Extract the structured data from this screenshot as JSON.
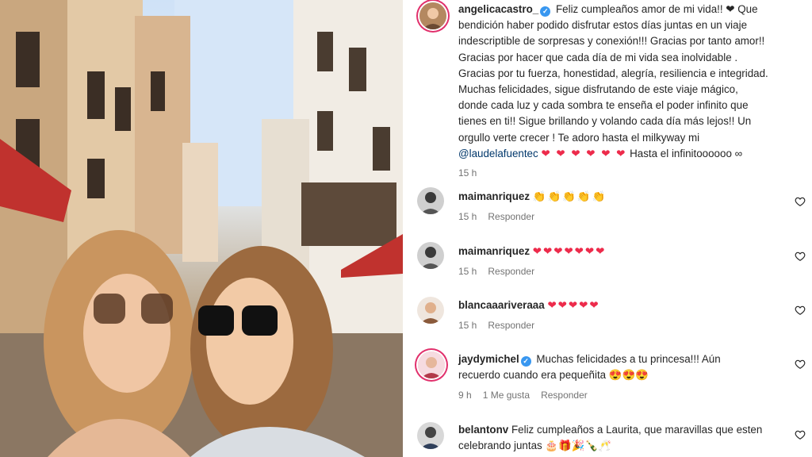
{
  "caption": {
    "username": "angelicacastro_",
    "text_lines": [
      "Feliz cumpleaños amor de mi vida!! ❤ Que",
      "bendición haber podido disfrutar estos días juntas en un viaje",
      "indescriptible de sorpresas y conexión!!! Gracias por tanto amor!!",
      "Gracias por hacer que cada día de mi vida sea inolvidable .",
      "Gracias por tu fuerza, honestidad, alegría, resiliencia e integridad.",
      "Muchas felicidades, sigue disfrutando de este viaje mágico,",
      "donde cada luz y cada sombra te enseña el poder infinito que",
      "tienes en ti!! Sigue brillando y volando cada día más lejos!! Un",
      "orgullo verte crecer ! Te adoro hasta el milkyway mi"
    ],
    "mention": "@laudelafuentec",
    "hearts": "❤ ❤ ❤ ❤ ❤ ❤",
    "tail": "Hasta el infinitoooooo ∞",
    "time": "15 h"
  },
  "comments": [
    {
      "username": "maimanriquez",
      "text": "👏👏👏👏👏",
      "time": "15 h",
      "reply": "Responder",
      "likes": ""
    },
    {
      "username": "maimanriquez",
      "text": "❤❤❤❤❤❤❤",
      "time": "15 h",
      "reply": "Responder",
      "likes": ""
    },
    {
      "username": "blancaaariveraaa",
      "text": "❤❤❤❤❤",
      "time": "15 h",
      "reply": "Responder",
      "likes": ""
    },
    {
      "username": "jaydymichel",
      "text": "Muchas felicidades a tu princesa!!! Aún",
      "text2": "recuerdo cuando era pequeñita 😍😍😍",
      "time": "9 h",
      "reply": "Responder",
      "likes": "1 Me gusta"
    },
    {
      "username": "belantonv",
      "text": "Feliz cumpleaños a Laurita, que maravillas que esten",
      "text2": "celebrando juntas 🎂🎁🎉🍾🥂",
      "time": "",
      "reply": "",
      "likes": ""
    }
  ],
  "colors": {
    "heart": "#ed2b4b",
    "verified": "#3897f0",
    "muted": "#737373",
    "mention": "#00376b"
  },
  "icons": [
    "verified-icon",
    "heart-outline-icon",
    "avatar"
  ]
}
